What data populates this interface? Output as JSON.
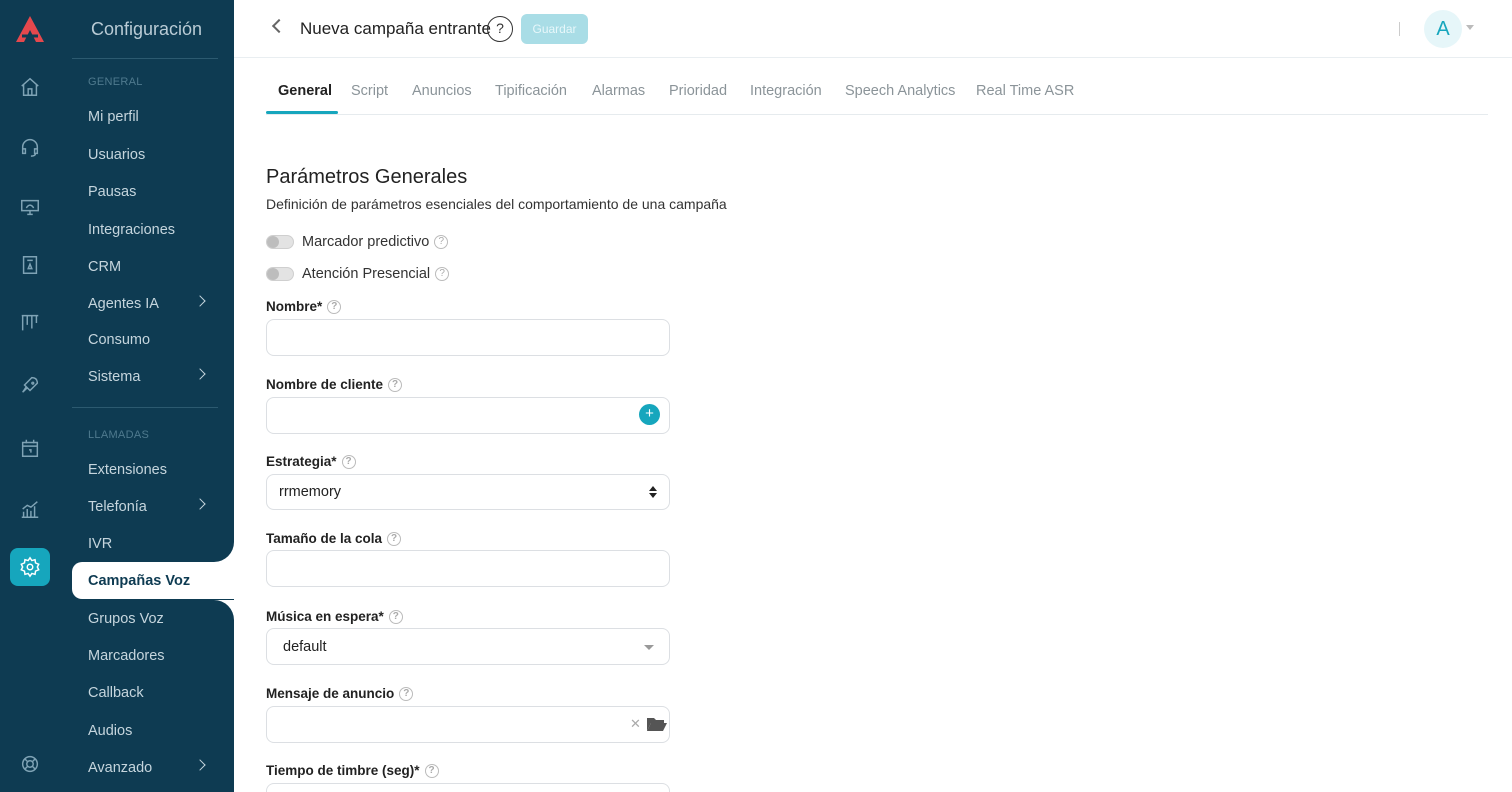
{
  "header": {
    "title": "Nueva campaña entrante",
    "help": "?",
    "save_label": "Guardar",
    "avatar_letter": "A"
  },
  "sidebar": {
    "title": "Configuración",
    "sections": [
      {
        "label": "GENERAL"
      },
      {
        "label": "LLAMADAS"
      }
    ],
    "items": [
      {
        "label": "Mi perfil"
      },
      {
        "label": "Usuarios"
      },
      {
        "label": "Pausas"
      },
      {
        "label": "Integraciones"
      },
      {
        "label": "CRM"
      },
      {
        "label": "Agentes IA"
      },
      {
        "label": "Consumo"
      },
      {
        "label": "Sistema"
      },
      {
        "label": "Extensiones"
      },
      {
        "label": "Telefonía"
      },
      {
        "label": "IVR"
      },
      {
        "label": "Campañas Voz"
      },
      {
        "label": "Grupos Voz"
      },
      {
        "label": "Marcadores"
      },
      {
        "label": "Callback"
      },
      {
        "label": "Audios"
      },
      {
        "label": "Avanzado"
      }
    ]
  },
  "rail": {
    "icons": [
      "home-icon",
      "headset-icon",
      "monitor-icon",
      "phone-book-icon",
      "kanban-icon",
      "rocket-icon",
      "calendar-icon",
      "chart-icon",
      "gear-icon",
      "support-icon"
    ]
  },
  "tabs": [
    {
      "label": "General"
    },
    {
      "label": "Script"
    },
    {
      "label": "Anuncios"
    },
    {
      "label": "Tipificación"
    },
    {
      "label": "Alarmas"
    },
    {
      "label": "Prioridad"
    },
    {
      "label": "Integración"
    },
    {
      "label": "Speech Analytics"
    },
    {
      "label": "Real Time ASR"
    }
  ],
  "form": {
    "heading": "Parámetros Generales",
    "description": "Definición de parámetros esenciales del comportamiento de una campaña",
    "toggles": [
      {
        "label": "Marcador predictivo",
        "on": false
      },
      {
        "label": "Atención Presencial",
        "on": false
      }
    ],
    "fields": {
      "nombre": {
        "label": "Nombre*",
        "value": ""
      },
      "cliente": {
        "label": "Nombre de cliente",
        "value": ""
      },
      "estrategia": {
        "label": "Estrategia*",
        "value": "rrmemory"
      },
      "cola": {
        "label": "Tamaño de la cola",
        "value": ""
      },
      "musica": {
        "label": "Música en espera*",
        "value": "default"
      },
      "anuncio": {
        "label": "Mensaje de anuncio",
        "value": ""
      },
      "timbre": {
        "label": "Tiempo de timbre (seg)*",
        "value": ""
      }
    }
  },
  "colors": {
    "sidebar_bg": "#0e3b52",
    "accent": "#16a6bd"
  }
}
